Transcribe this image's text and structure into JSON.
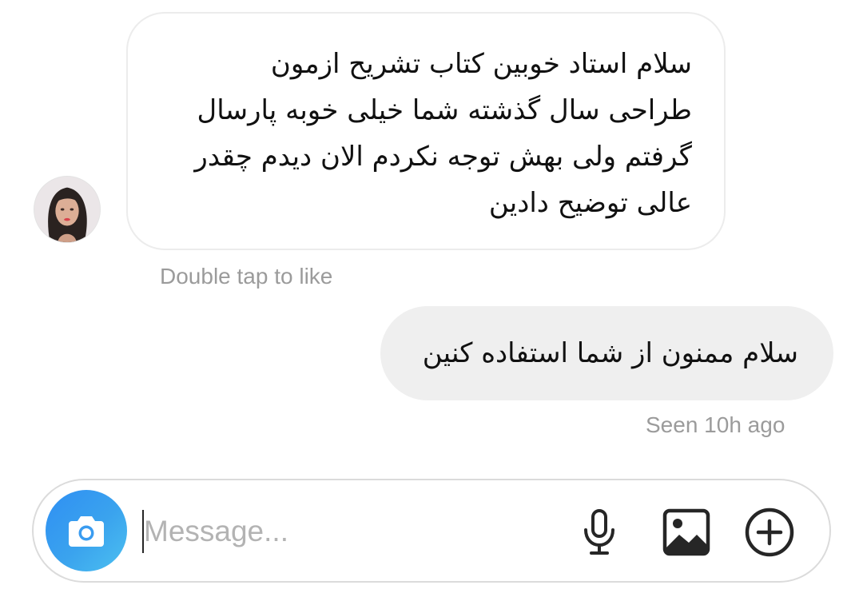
{
  "thread": {
    "incoming": {
      "avatar_icon": "user-avatar-photo",
      "text_lines": [
        "سلام استاد  خوبین کتاب تشریح ازمون",
        "طراحی سال گذشته شما خیلی خوبه پارسال",
        "گرفتم ولی بهش توجه نکردم الان دیدم چقدر",
        "عالی توضیح دادین"
      ],
      "hint": "Double tap to like"
    },
    "outgoing": {
      "text": "سلام ممنون از شما استفاده کنین",
      "status": "Seen 10h ago"
    }
  },
  "composer": {
    "camera_icon": "camera-icon",
    "placeholder": "Message...",
    "value": "",
    "icons": [
      "microphone-icon",
      "gallery-icon",
      "add-circle-icon"
    ],
    "accent_colors": [
      "#2f8ff3",
      "#4cc0f0"
    ]
  }
}
